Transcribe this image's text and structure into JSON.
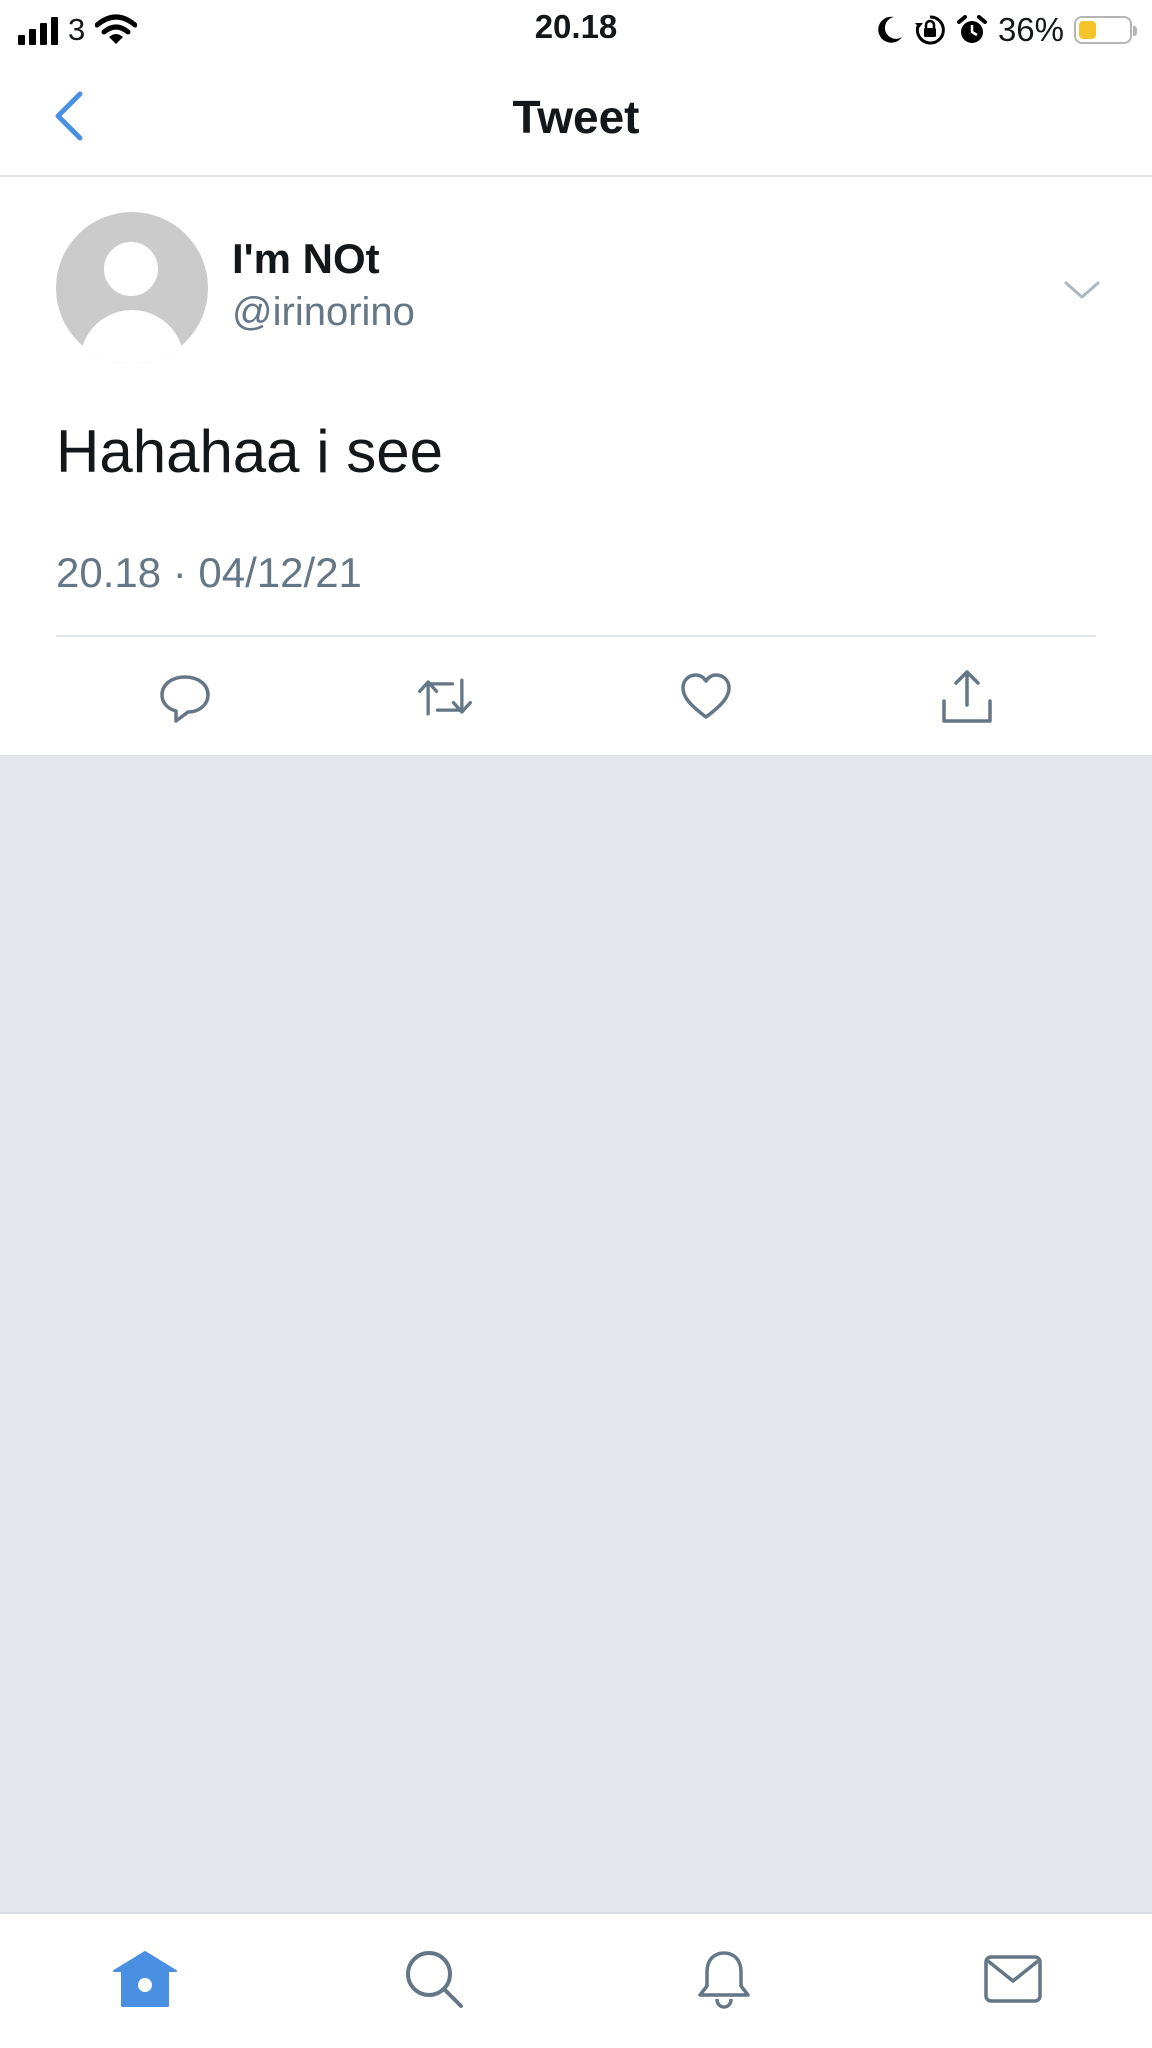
{
  "status_bar": {
    "carrier": "3",
    "time": "20.18",
    "battery_percent": "36%",
    "battery_level": 0.36,
    "icons": [
      "signal-icon",
      "wifi-icon",
      "moon-icon",
      "rotation-lock-icon",
      "alarm-icon",
      "battery-icon"
    ]
  },
  "nav": {
    "title": "Tweet",
    "back_icon": "chevron-left-icon"
  },
  "tweet": {
    "display_name": "I'm NOt",
    "handle": "@irinorino",
    "text": "Hahahaa i see",
    "timestamp": "20.18 · 04/12/21",
    "actions": [
      "reply-icon",
      "retweet-icon",
      "like-icon",
      "share-icon"
    ]
  },
  "tab_bar": {
    "tabs": [
      "home-icon",
      "search-icon",
      "notifications-icon",
      "messages-icon"
    ],
    "active": "home"
  },
  "colors": {
    "accent": "#4a90e2",
    "icon_gray": "#657786",
    "background": "#e6e7ec",
    "battery_fill": "#f5c32c"
  }
}
